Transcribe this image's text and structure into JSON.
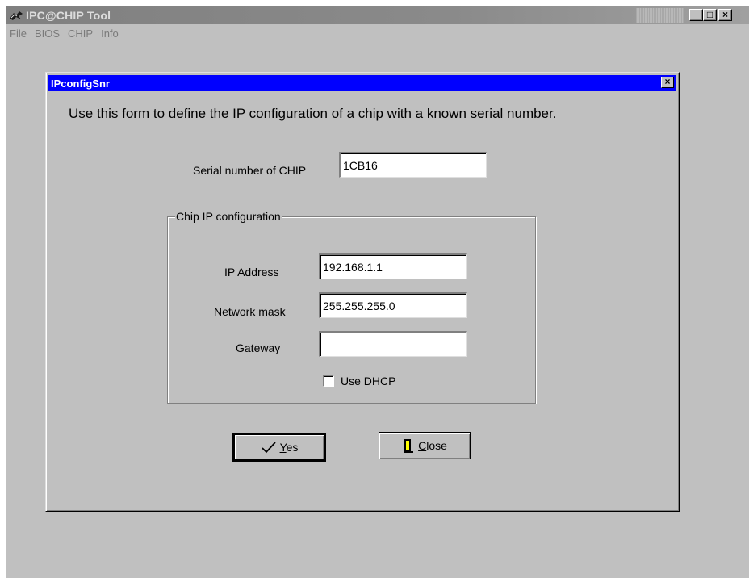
{
  "app": {
    "title": "IPC@CHIP Tool",
    "menu": [
      {
        "label": "File"
      },
      {
        "label": "BIOS"
      },
      {
        "label": "CHIP"
      },
      {
        "label": "Info"
      }
    ],
    "window_buttons": {
      "minimize": "_",
      "maximize": "□",
      "close": "×"
    }
  },
  "dialog": {
    "title": "IPconfigSnr",
    "close_glyph": "×",
    "intro": "Use this form to define the IP configuration of a chip with a known serial number.",
    "serial": {
      "label": "Serial number of CHIP",
      "value": "1CB16"
    },
    "group": {
      "legend": "Chip IP configuration",
      "ip": {
        "label": "IP Address",
        "value": "192.168.1.1"
      },
      "mask": {
        "label": "Network mask",
        "value": "255.255.255.0"
      },
      "gateway": {
        "label": "Gateway",
        "value": ""
      },
      "dhcp": {
        "label": "Use DHCP",
        "checked": false
      }
    },
    "buttons": {
      "yes": "Yes",
      "close": "Close"
    }
  },
  "colors": {
    "dialog_titlebar": "#0000ff",
    "app_titlebar_inactive": "#808080",
    "face": "#c0c0c0"
  },
  "icons": [
    "app-logo-icon",
    "checkmark-icon",
    "door-exit-icon"
  ]
}
